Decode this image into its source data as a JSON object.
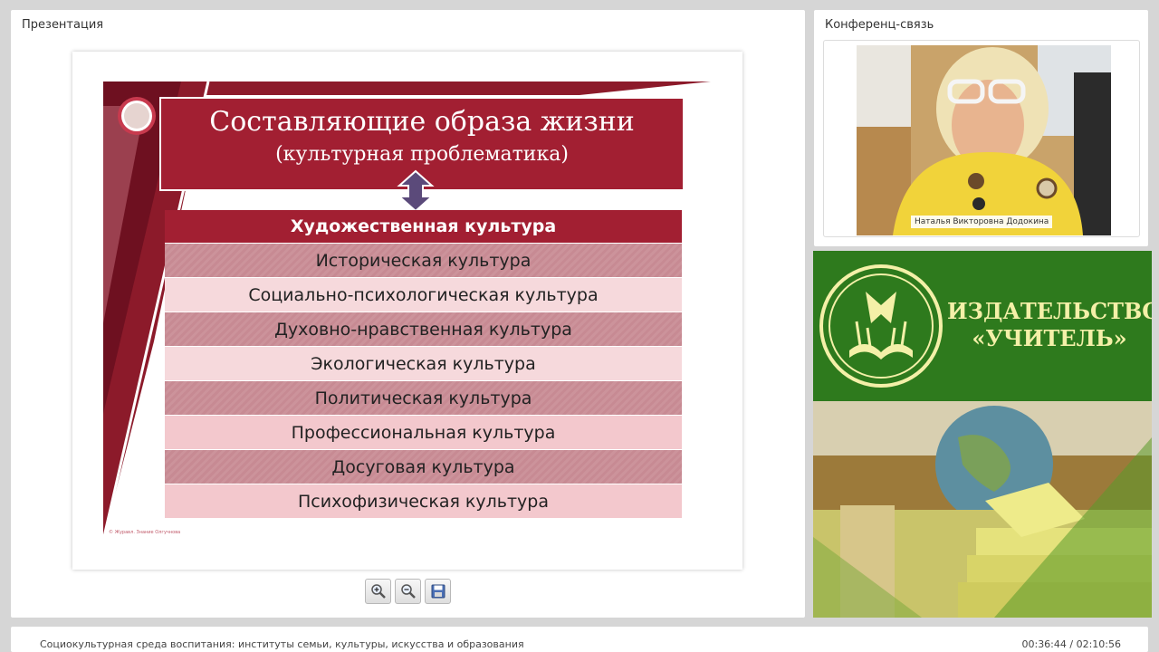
{
  "presentation": {
    "panel_title": "Презентация",
    "slide": {
      "title": "Составляющие образа жизни",
      "subtitle": "(культурная проблематика)",
      "rows": [
        "Художественная культура",
        "Историческая культура",
        "Социально-психологическая культура",
        "Духовно-нравственная культура",
        "Экологическая культура",
        "Политическая культура",
        "Профессиональная культура",
        "Досуговая культура",
        "Психофизическая культура"
      ],
      "footer": "© Журавл. Знание Олгучнова"
    },
    "toolbar": {
      "zoom_in_icon": "zoom-in-icon",
      "zoom_out_icon": "zoom-out-icon",
      "save_icon": "save-icon"
    }
  },
  "conference": {
    "panel_title": "Конференц-связь",
    "participant_name": "Наталья Викторовна Додокина"
  },
  "banner": {
    "publisher_line1": "ИЗДАТЕЛЬСТВО",
    "publisher_line2": "«УЧИТЕЛЬ»"
  },
  "footer": {
    "course_title": "Социокультурная среда воспитания: институты семьи, культуры, искусства и образования",
    "time": "00:36:44 / 02:10:56"
  },
  "colors": {
    "slide_accent": "#a21f32",
    "banner_green": "#2e7a1d",
    "banner_text": "#f4f0a8"
  }
}
